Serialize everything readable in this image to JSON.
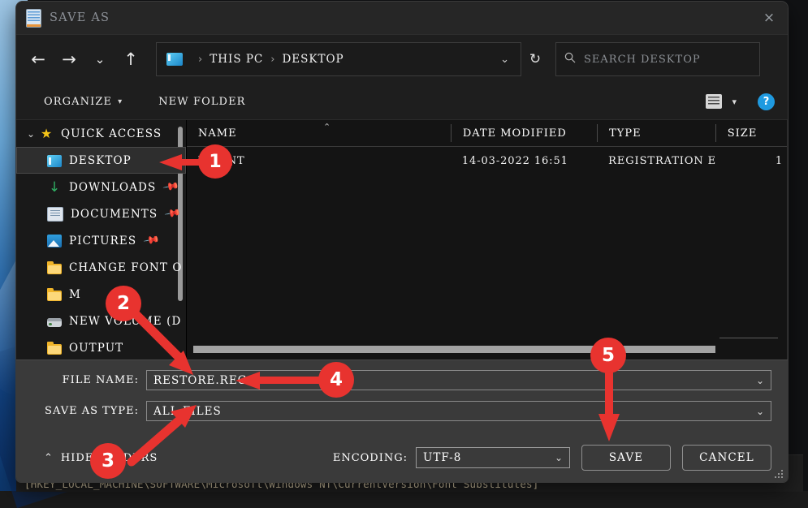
{
  "window": {
    "title": "SAVE AS",
    "icon": "notepad-icon",
    "close_label": "×"
  },
  "nav": {
    "back": "←",
    "forward": "→",
    "recent": "⌄",
    "up": "↑",
    "refresh": "↻",
    "address": {
      "icon": "this-pc-icon",
      "crumbs": [
        "THIS PC",
        "DESKTOP"
      ],
      "separator": "›",
      "caret": "⌄"
    },
    "search": {
      "icon": "search-icon",
      "placeholder": "SEARCH DESKTOP",
      "value": ""
    }
  },
  "toolbar": {
    "organize_label": "ORGANIZE",
    "organize_caret": "▾",
    "new_folder_label": "NEW FOLDER",
    "view_caret": "▾",
    "help_label": "?"
  },
  "sidebar": {
    "groups": [
      {
        "label": "QUICK ACCESS",
        "icon": "star-icon",
        "chevron": "⌄",
        "items": [
          {
            "label": "DESKTOP",
            "icon": "desktop-icon",
            "pinned": false,
            "selected": true
          },
          {
            "label": "DOWNLOADS",
            "icon": "download-icon",
            "pinned": true,
            "selected": false
          },
          {
            "label": "DOCUMENTS",
            "icon": "document-icon",
            "pinned": true,
            "selected": false
          },
          {
            "label": "PICTURES",
            "icon": "picture-icon",
            "pinned": true,
            "selected": false
          },
          {
            "label": "CHANGE FONT O",
            "icon": "folder-icon",
            "pinned": false,
            "selected": false
          },
          {
            "label": "M",
            "icon": "folder-icon",
            "pinned": false,
            "selected": false
          },
          {
            "label": "NEW VOLUME (D",
            "icon": "drive-icon",
            "pinned": false,
            "selected": false
          },
          {
            "label": "OUTPUT",
            "icon": "folder-icon",
            "pinned": false,
            "selected": false
          }
        ]
      }
    ]
  },
  "filelist": {
    "columns": [
      "NAME",
      "DATE MODIFIED",
      "TYPE",
      "SIZE"
    ],
    "sort_indicator": "⌃",
    "rows": [
      {
        "name": "WFONT",
        "date_modified": "14-03-2022 16:51",
        "type": "REGISTRATION E...",
        "size": "1 "
      }
    ]
  },
  "form": {
    "file_name_label": "FILE NAME:",
    "file_name_value": "RESTORE.REG",
    "save_as_type_label": "SAVE AS TYPE:",
    "save_as_type_value": "ALL FILES",
    "dropdown_caret": "⌄"
  },
  "footer": {
    "hide_folders_label": "HIDE FOLDERS",
    "hide_folders_caret": "⌃",
    "encoding_label": "ENCODING:",
    "encoding_value": "UTF-8",
    "encoding_caret": "⌄",
    "save_label": "SAVE",
    "cancel_label": "CANCEL"
  },
  "background": {
    "notepad_text": "[HKEY_LOCAL_MACHINE\\SOFTWARE\\Microsoft\\Windows NT\\CurrentVersion\\Font Substitutes]"
  },
  "annotations": {
    "accent_color": "#e8332f",
    "markers": [
      {
        "number": "1",
        "target": "desktop-sidebar-item"
      },
      {
        "number": "2",
        "target": "file-name-field"
      },
      {
        "number": "3",
        "target": "save-as-type-field"
      },
      {
        "number": "4",
        "target": "file-name-value"
      },
      {
        "number": "5",
        "target": "save-button"
      }
    ]
  }
}
